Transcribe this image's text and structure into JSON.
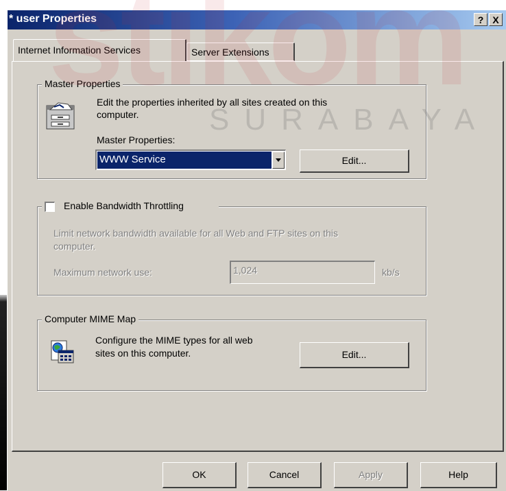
{
  "watermark": {
    "big": "stikom",
    "small": "SURABAYA"
  },
  "window": {
    "title": "* user Properties",
    "help_btn": "?",
    "close_btn": "X"
  },
  "tabs": [
    {
      "label": "Internet Information Services",
      "active": true
    },
    {
      "label": "Server Extensions",
      "active": false
    }
  ],
  "master": {
    "legend": "Master Properties",
    "description_line1": "Edit the properties inherited by all sites created on this",
    "description_line2": "computer.",
    "select_label": "Master Properties:",
    "select_value": "WWW Service",
    "edit_label": "Edit..."
  },
  "bandwidth": {
    "checkbox_label": "Enable Bandwidth Throttling",
    "checked": false,
    "description_line1": "Limit network bandwidth available for all Web and FTP sites on this",
    "description_line2": "computer.",
    "max_label": "Maximum network use:",
    "max_value": "1,024",
    "unit": "kb/s"
  },
  "mime": {
    "legend": "Computer MIME Map",
    "description_line1": "Configure the MIME types for all web",
    "description_line2": "sites on this computer.",
    "edit_label": "Edit..."
  },
  "footer": {
    "ok": "OK",
    "cancel": "Cancel",
    "apply": "Apply",
    "help": "Help"
  },
  "colors": {
    "face": "#d4d0c8",
    "title_start": "#0a246a",
    "title_end": "#a6caf0",
    "selection": "#0a246a"
  }
}
